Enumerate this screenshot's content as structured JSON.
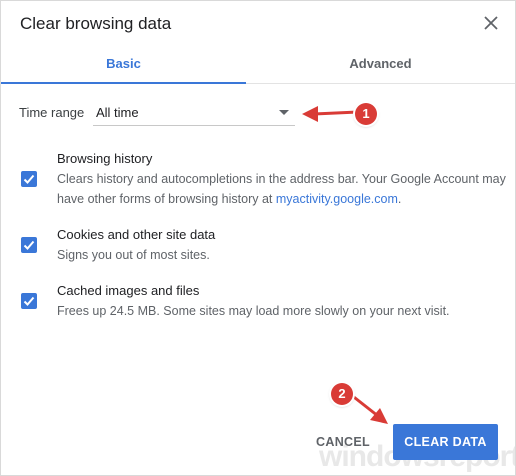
{
  "dialog": {
    "title": "Clear browsing data"
  },
  "tabs": [
    {
      "label": "Basic",
      "active": true
    },
    {
      "label": "Advanced",
      "active": false
    }
  ],
  "time_range": {
    "label": "Time range",
    "value": "All time"
  },
  "options": [
    {
      "title": "Browsing history",
      "description_prefix": "Clears history and autocompletions in the address bar. Your Google Account may have other forms of browsing history at ",
      "link_text": "myactivity.google.com",
      "description_suffix": ".",
      "checked": true
    },
    {
      "title": "Cookies and other site data",
      "description": "Signs you out of most sites.",
      "checked": true
    },
    {
      "title": "Cached images and files",
      "description": "Frees up 24.5 MB. Some sites may load more slowly on your next visit.",
      "checked": true
    }
  ],
  "buttons": {
    "cancel": "CANCEL",
    "clear": "CLEAR DATA"
  },
  "annotations": {
    "step1": "1",
    "step2": "2"
  },
  "watermark": "windowsreport",
  "colors": {
    "accent": "#3a77d8",
    "annotation": "#d93b36"
  }
}
